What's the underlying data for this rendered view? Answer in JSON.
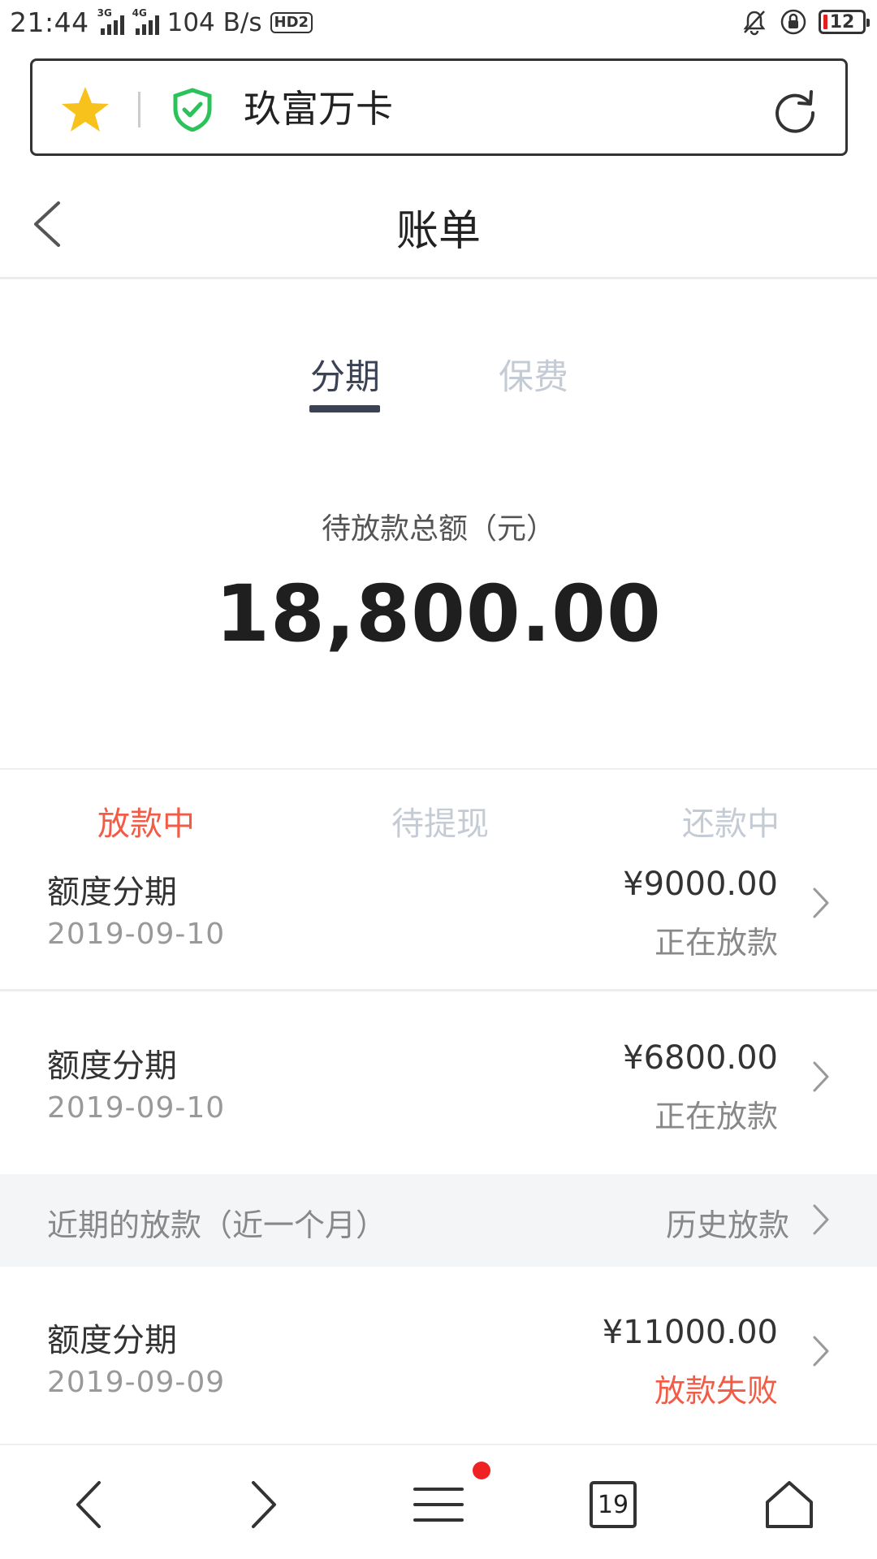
{
  "status_bar": {
    "time": "21:44",
    "sim1_tag": "3G",
    "sim2_tag": "4G",
    "net_speed": "104 B/s",
    "hd_badge": "HD2",
    "battery_level": "12"
  },
  "address_bar": {
    "site_title": "玖富万卡",
    "icons": [
      "star-icon",
      "shield-check-icon",
      "reload-icon"
    ]
  },
  "header": {
    "title": "账单",
    "back_icon": "chevron-left-icon"
  },
  "main_tabs": [
    {
      "label": "分期",
      "active": true
    },
    {
      "label": "保费",
      "active": false
    }
  ],
  "summary": {
    "label": "待放款总额（元）",
    "amount": "18,800.00"
  },
  "status_tabs": [
    {
      "label": "放款中",
      "active": true
    },
    {
      "label": "待提现",
      "active": false
    },
    {
      "label": "还款中",
      "active": false
    }
  ],
  "loans_in_progress": [
    {
      "name": "额度分期",
      "date": "2019-09-10",
      "amount": "¥9000.00",
      "status": "正在放款"
    },
    {
      "name": "额度分期",
      "date": "2019-09-10",
      "amount": "¥6800.00",
      "status": "正在放款"
    }
  ],
  "recent_section": {
    "title": "近期的放款（近一个月）",
    "link": "历史放款"
  },
  "recent_loans": [
    {
      "name": "额度分期",
      "date": "2019-09-09",
      "amount": "¥11000.00",
      "status": "放款失败"
    }
  ],
  "bottom_nav": {
    "tab_count": "19",
    "items": [
      "back-icon",
      "forward-icon",
      "menu-icon",
      "tabs-icon",
      "home-icon"
    ]
  },
  "colors": {
    "accent_red": "#f25c46",
    "tab_active": "#3b4256",
    "tab_inactive": "#c4cbd4",
    "shield_green": "#2bc25a",
    "star_yellow": "#f7c21b"
  }
}
